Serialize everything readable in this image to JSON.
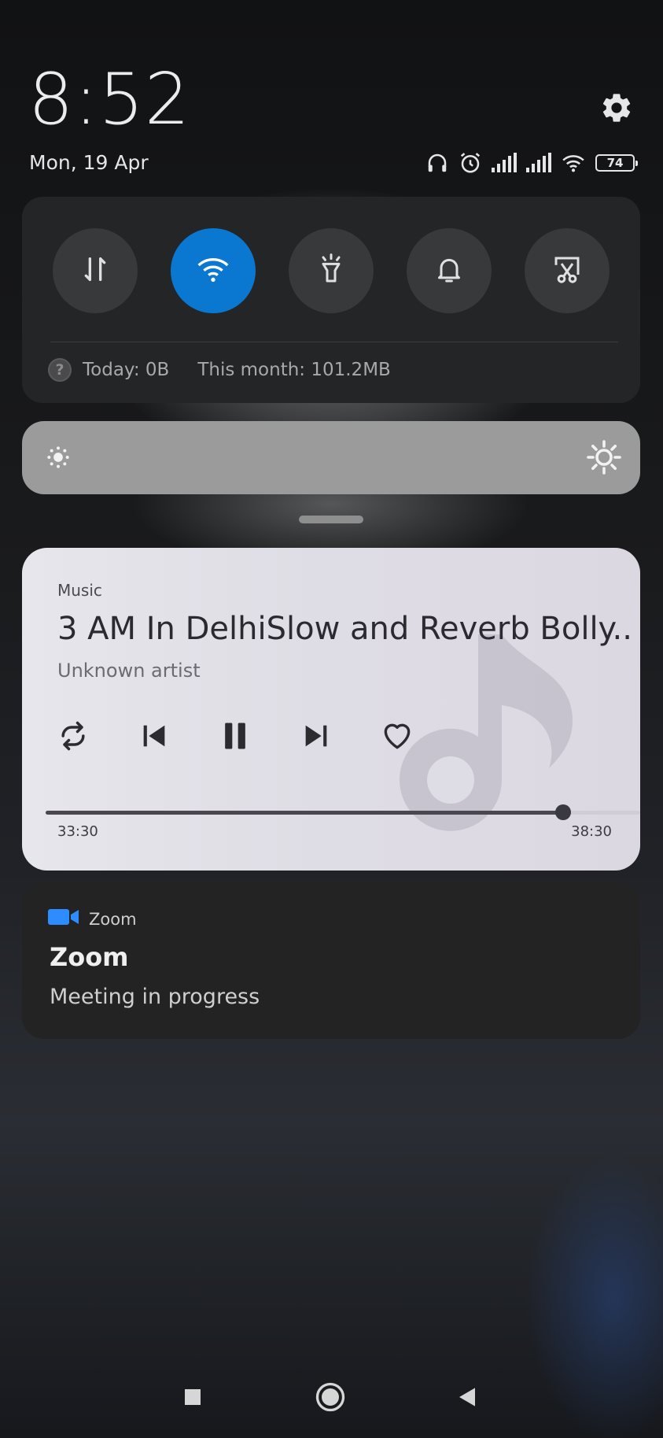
{
  "header": {
    "time": "8:52",
    "date": "Mon, 19 Apr",
    "battery_level": "74"
  },
  "quick_settings": {
    "tiles": [
      {
        "name": "Mobile data",
        "icon": "data-transfer-icon",
        "active": false
      },
      {
        "name": "Wi-Fi",
        "icon": "wifi-icon",
        "active": true
      },
      {
        "name": "Torch",
        "icon": "flashlight-icon",
        "active": false
      },
      {
        "name": "Sound",
        "icon": "bell-icon",
        "active": false
      },
      {
        "name": "Screenshot",
        "icon": "scissors-screenshot-icon",
        "active": false
      }
    ],
    "data_today": "Today: 0B",
    "data_month": "This month: 101.2MB"
  },
  "brightness": {
    "level": 0.0
  },
  "music": {
    "app": "Music",
    "title": "3 AM In DelhiSlow and Reverb Bolly..",
    "artist": "Unknown artist",
    "elapsed": "33:30",
    "duration": "38:30",
    "progress": 0.87
  },
  "zoom_notification": {
    "app": "Zoom",
    "title": "Zoom",
    "message": "Meeting in progress",
    "accent": "#2D8CFF"
  },
  "colors": {
    "wifi_active": "#0A78D0"
  }
}
